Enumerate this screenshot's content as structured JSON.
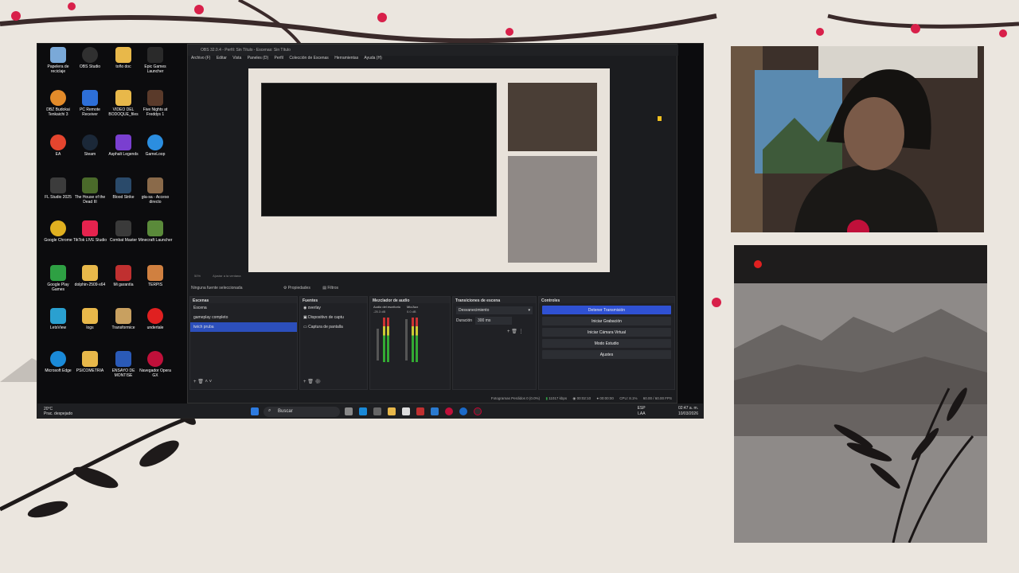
{
  "desktop": {
    "icons": [
      {
        "label": "Papelera de reciclaje",
        "color": "#7aa9d8"
      },
      {
        "label": "OBS Studio",
        "color": "#303030"
      },
      {
        "label": "toño doc",
        "color": "#e8b84a"
      },
      {
        "label": "Epic Games Launcher",
        "color": "#2a2a2a"
      },
      {
        "label": "DBZ Budokai Tenkaichi 3",
        "color": "#e38b2a"
      },
      {
        "label": "PC Remote Receiver",
        "color": "#2d6fd8"
      },
      {
        "label": "VIDEO DEL BODOQUE_files",
        "color": "#e8b84a"
      },
      {
        "label": "Five Nights at Freddys 1",
        "color": "#5a3a2a"
      },
      {
        "label": "EA",
        "color": "#e5452e"
      },
      {
        "label": "Steam",
        "color": "#1b2838"
      },
      {
        "label": "Asphalt Legends",
        "color": "#7a3fd0"
      },
      {
        "label": "GameLoop",
        "color": "#2b8ee0"
      },
      {
        "label": "FL Studio 2025",
        "color": "#3c3c3c"
      },
      {
        "label": "The House of the Dead III",
        "color": "#4a6a2a"
      },
      {
        "label": "Blood Strike",
        "color": "#2a4a6a"
      },
      {
        "label": "gta-sa - Acceso directo",
        "color": "#8a6a4a"
      },
      {
        "label": "Google Chrome",
        "color": "#e0b020"
      },
      {
        "label": "TikTok LIVE Studio",
        "color": "#e5234e"
      },
      {
        "label": "Combat Master",
        "color": "#3a3a3a"
      },
      {
        "label": "Minecraft Launcher",
        "color": "#5a8a3a"
      },
      {
        "label": "Google Play Games",
        "color": "#2ea043"
      },
      {
        "label": "dolphin-2509-x64",
        "color": "#e8b84a"
      },
      {
        "label": "Mi garantía",
        "color": "#c03030"
      },
      {
        "label": "TERPIS",
        "color": "#d08040"
      },
      {
        "label": "LetsView",
        "color": "#2aa0d0"
      },
      {
        "label": "logs",
        "color": "#e8b84a"
      },
      {
        "label": "Transformice",
        "color": "#c8a060"
      },
      {
        "label": "undertale",
        "color": "#e02020"
      },
      {
        "label": "Microsoft Edge",
        "color": "#1a8ad8"
      },
      {
        "label": "PSICOMETRIA",
        "color": "#e8b84a"
      },
      {
        "label": "ENSAYO DE MONTISE",
        "color": "#2a5ab8"
      },
      {
        "label": "Navegador Opera GX",
        "color": "#c0103a"
      }
    ],
    "weather": {
      "temp": "20°C",
      "desc": "Prac. despejado"
    },
    "search_label": "Buscar",
    "tray": {
      "lang": "ESP",
      "lang2": "LAA",
      "time": "02:47 a. m.",
      "date": "10/03/2026"
    }
  },
  "obs": {
    "title": "OBS 32.0.4 - Perfil: Sin Título - Escenas: Sin Título",
    "menu": [
      "Archivo (F)",
      "Editar",
      "Vista",
      "Paneles (D)",
      "Perfil",
      "Colección de Escenas",
      "Herramientas",
      "Ayuda (H)"
    ],
    "preview_zoom": "50%",
    "preview_fit": "Ajustar a la ventana",
    "no_source": "Ninguna fuente seleccionada",
    "properties": "Propiedades",
    "filters": "Filtros",
    "docks": {
      "scenes": {
        "title": "Escenas",
        "items": [
          "Escena",
          "gameplay completo",
          "twich pruba"
        ],
        "selected": 2
      },
      "sources": {
        "title": "Fuentes",
        "items": [
          "overlay",
          "Dispositivo de captu",
          "Captura de pantalla"
        ]
      },
      "mixer": {
        "title": "Mezclador de audio",
        "channels": [
          {
            "name": "Audio del escritorio",
            "db": "-25.3 dB"
          },
          {
            "name": "Mic/Aux",
            "db": "0.0 dB"
          }
        ]
      },
      "transitions": {
        "title": "Transiciones de escena",
        "value": "Desvanecimiento",
        "duration_label": "Duración",
        "duration_value": "300 ms"
      },
      "controls": {
        "title": "Controles",
        "buttons": [
          "Detener Transmisión",
          "Iniciar Grabación",
          "Iniciar Cámara Virtual",
          "Modo Estudio",
          "Ajustes"
        ]
      }
    },
    "footer": {
      "dropped": "Fotogramas Perdidos 0 (0.0%)",
      "bitrate": "11017 kbps",
      "stream_time": "00:02:10",
      "rec_time": "00:00:00",
      "cpu": "CPU: 8.1%",
      "fps": "60.00 / 60.00 FPS"
    }
  },
  "colors": {
    "accent": "#2f51d3",
    "live": "#e02020",
    "petals": "#d8204a"
  }
}
